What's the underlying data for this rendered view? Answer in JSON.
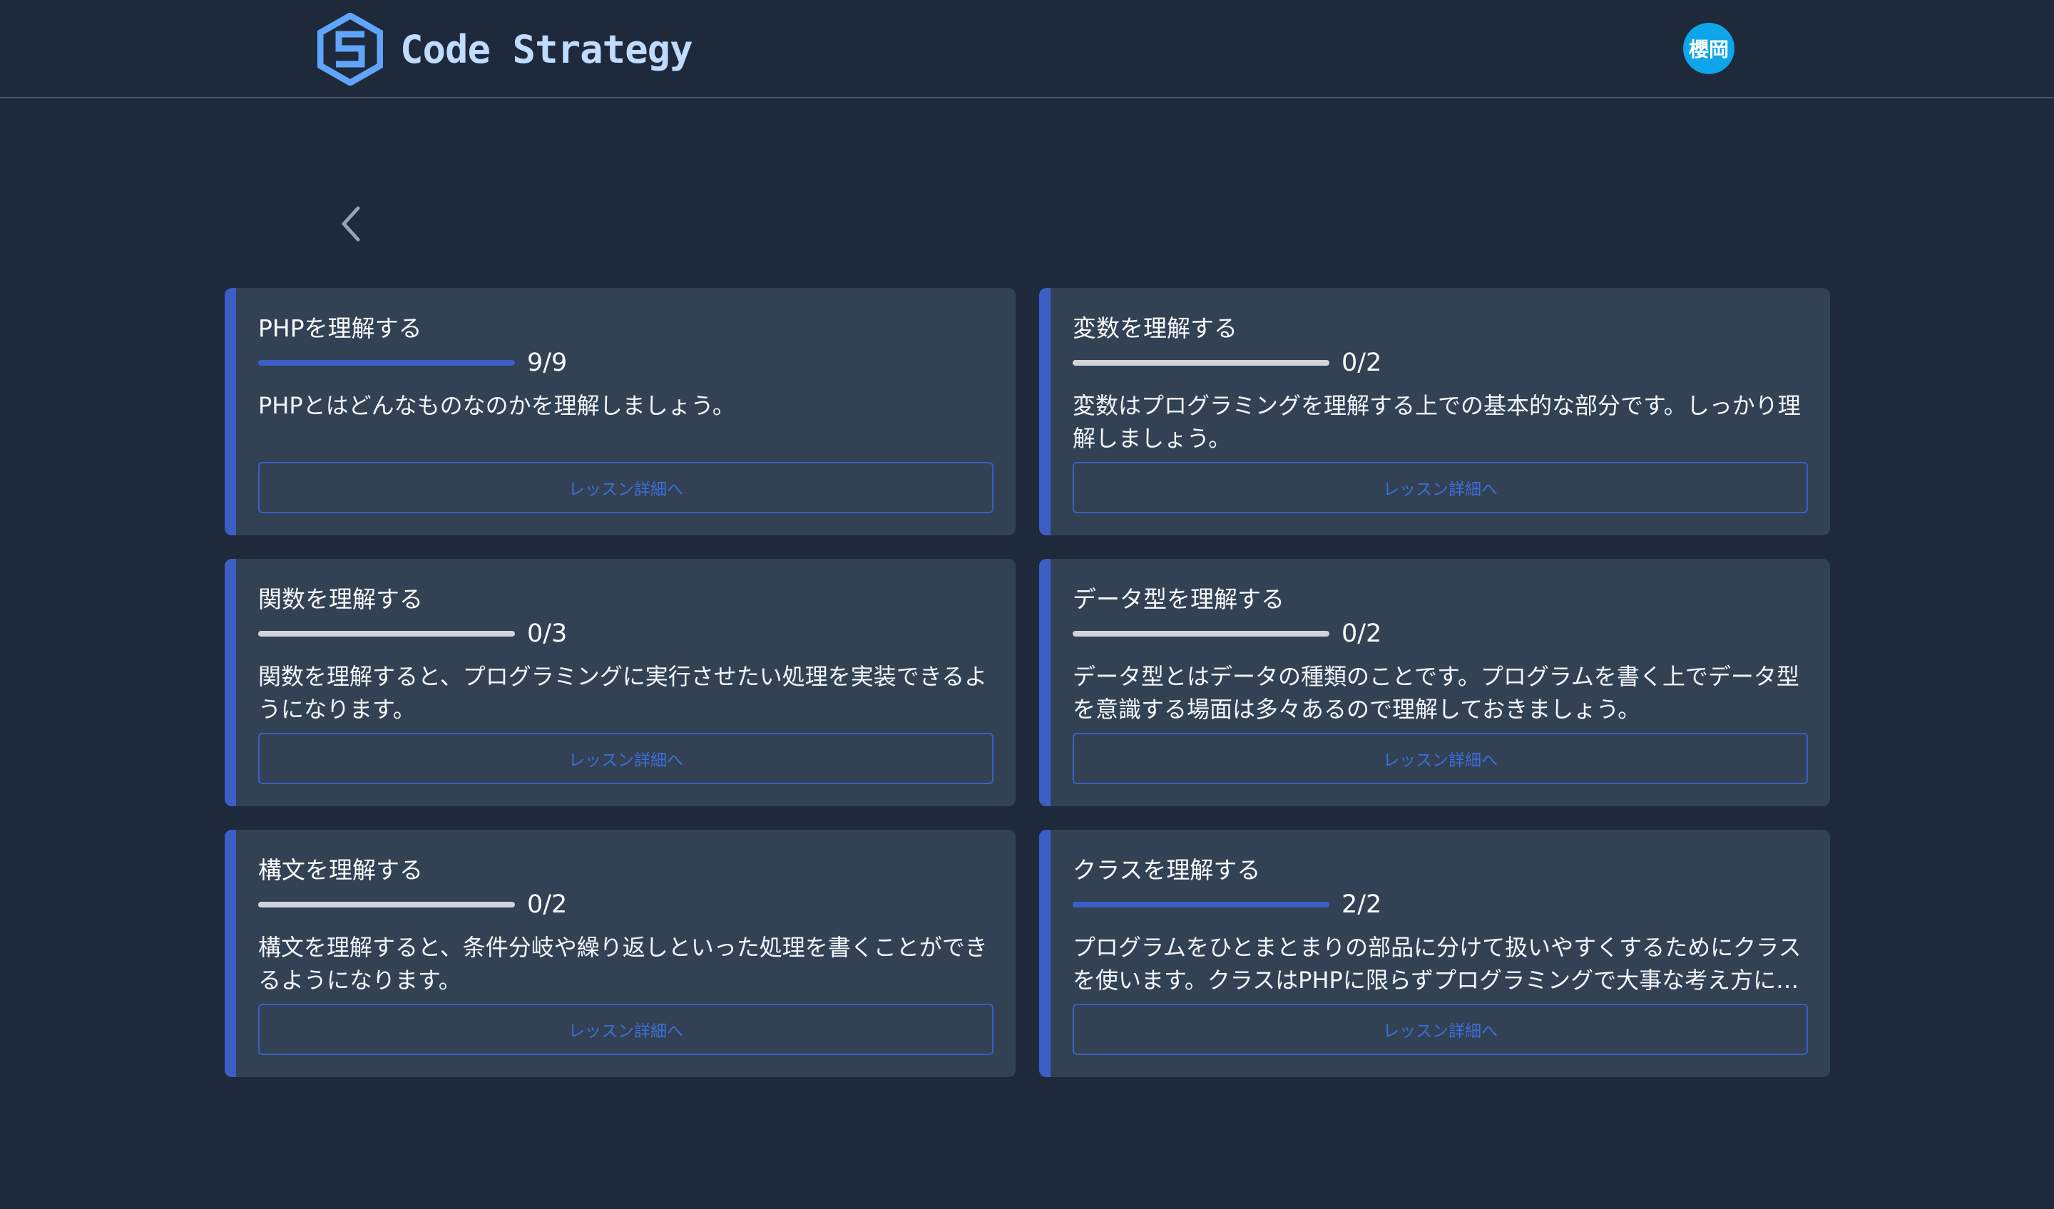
{
  "header": {
    "brand": "Code Strategy",
    "avatar_text": "櫻岡"
  },
  "colors": {
    "background": "#1e293b",
    "card": "#334155",
    "accent": "#3b5fc4",
    "track": "#d1d5db",
    "logo": "#60a5fa"
  },
  "lessons": [
    {
      "title": "PHPを理解する",
      "completed": 9,
      "total": 9,
      "progress_fraction": 1.0,
      "count_text": "9/9",
      "description": "PHPとはどんなものなのかを理解しましょう。",
      "button_label": "レッスン詳細へ"
    },
    {
      "title": "変数を理解する",
      "completed": 0,
      "total": 2,
      "progress_fraction": 0.0,
      "count_text": "0/2",
      "description": "変数はプログラミングを理解する上での基本的な部分です。しっかり理解しましょう。",
      "button_label": "レッスン詳細へ"
    },
    {
      "title": "関数を理解する",
      "completed": 0,
      "total": 3,
      "progress_fraction": 0.0,
      "count_text": "0/3",
      "description": "関数を理解すると、プログラミングに実行させたい処理を実装できるようになります。",
      "button_label": "レッスン詳細へ"
    },
    {
      "title": "データ型を理解する",
      "completed": 0,
      "total": 2,
      "progress_fraction": 0.0,
      "count_text": "0/2",
      "description": "データ型とはデータの種類のことです。プログラムを書く上でデータ型を意識する場面は多々あるので理解しておきましょう。",
      "button_label": "レッスン詳細へ"
    },
    {
      "title": "構文を理解する",
      "completed": 0,
      "total": 2,
      "progress_fraction": 0.0,
      "count_text": "0/2",
      "description": "構文を理解すると、条件分岐や繰り返しといった処理を書くことができるようになります。",
      "button_label": "レッスン詳細へ"
    },
    {
      "title": "クラスを理解する",
      "completed": 2,
      "total": 2,
      "progress_fraction": 1.0,
      "count_text": "2/2",
      "description": "プログラムをひとまとまりの部品に分けて扱いやすくするためにクラスを使います。クラスはPHPに限らずプログラミングで大事な考え方に…",
      "button_label": "レッスン詳細へ"
    }
  ]
}
